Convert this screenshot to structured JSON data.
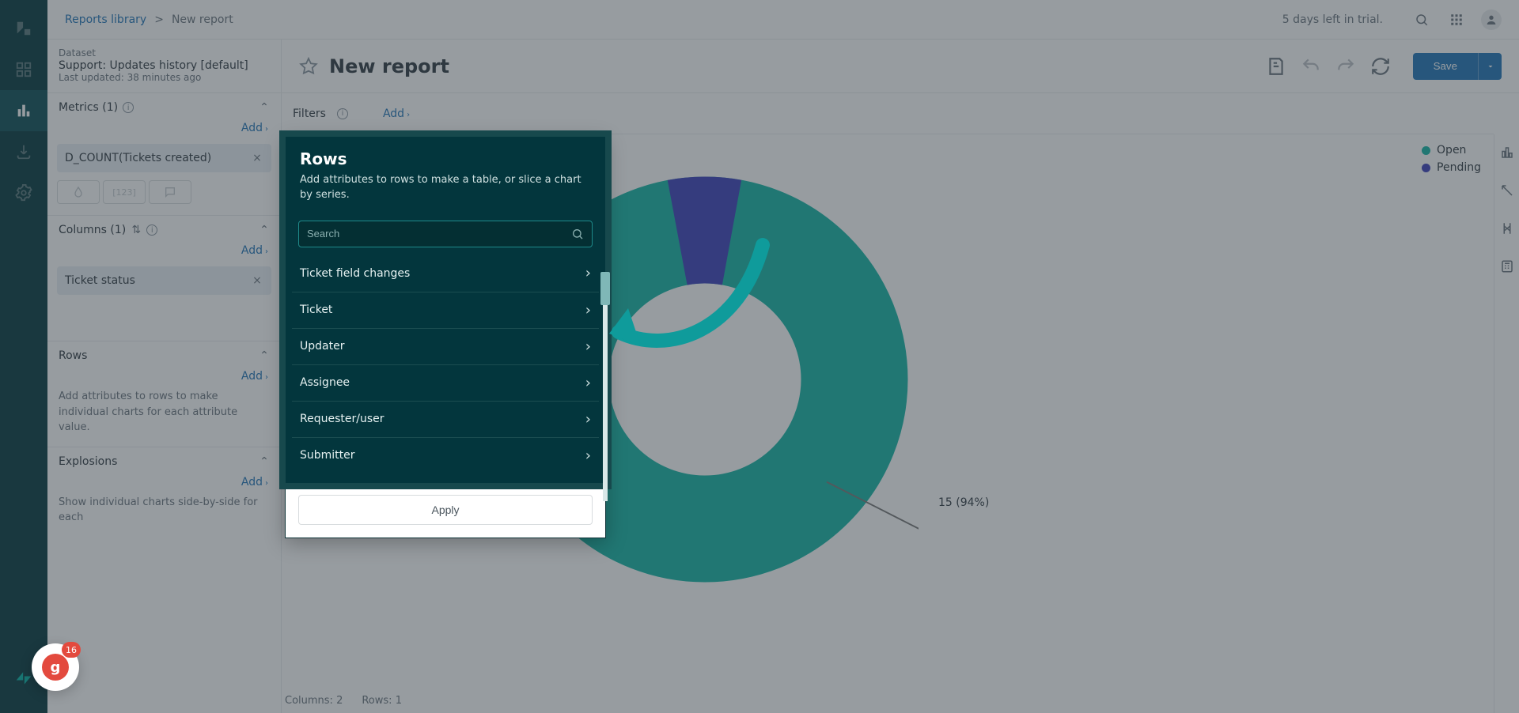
{
  "breadcrumb": {
    "root": "Reports library",
    "sep": ">",
    "current": "New report"
  },
  "trial": {
    "text": "5 days left in trial."
  },
  "report": {
    "title": "New report",
    "save_label": "Save"
  },
  "dataset": {
    "label": "Dataset",
    "name": "Support: Updates history [default]",
    "updated": "Last updated: 38 minutes ago"
  },
  "panel": {
    "metrics": {
      "label": "Metrics (1)",
      "add": "Add",
      "item": "D_COUNT(Tickets created)"
    },
    "columns": {
      "label": "Columns (1)",
      "add": "Add",
      "item": "Ticket status"
    },
    "rows": {
      "label": "Rows",
      "add": "Add",
      "hint": "Add attributes to rows to make individual charts for each attribute value."
    },
    "explosions": {
      "label": "Explosions",
      "add": "Add",
      "hint": "Show individual charts side-by-side for each"
    }
  },
  "filters": {
    "label": "Filters",
    "add": "Add"
  },
  "legend": {
    "open": "Open",
    "pending": "Pending"
  },
  "colors": {
    "open": "#12b5a5",
    "pending": "#3b3fba"
  },
  "chart_data": {
    "type": "pie",
    "title": "",
    "series": [
      {
        "name": "Open",
        "value": 15,
        "pct": 94,
        "label": "15 (94%)",
        "color": "#12b5a5"
      },
      {
        "name": "Pending",
        "value": 1,
        "pct": 6,
        "label": "",
        "color": "#3b3fba"
      }
    ]
  },
  "stats": {
    "columns_label": "Columns:",
    "columns_val": "2",
    "rows_label": "Rows:",
    "rows_val": "1"
  },
  "popover": {
    "title": "Rows",
    "desc": "Add attributes to rows to make a table, or slice a chart by series.",
    "search_placeholder": "Search",
    "items": [
      "Ticket field changes",
      "Ticket",
      "Updater",
      "Assignee",
      "Requester/user",
      "Submitter"
    ],
    "apply": "Apply"
  },
  "guide": {
    "badge": "16"
  }
}
